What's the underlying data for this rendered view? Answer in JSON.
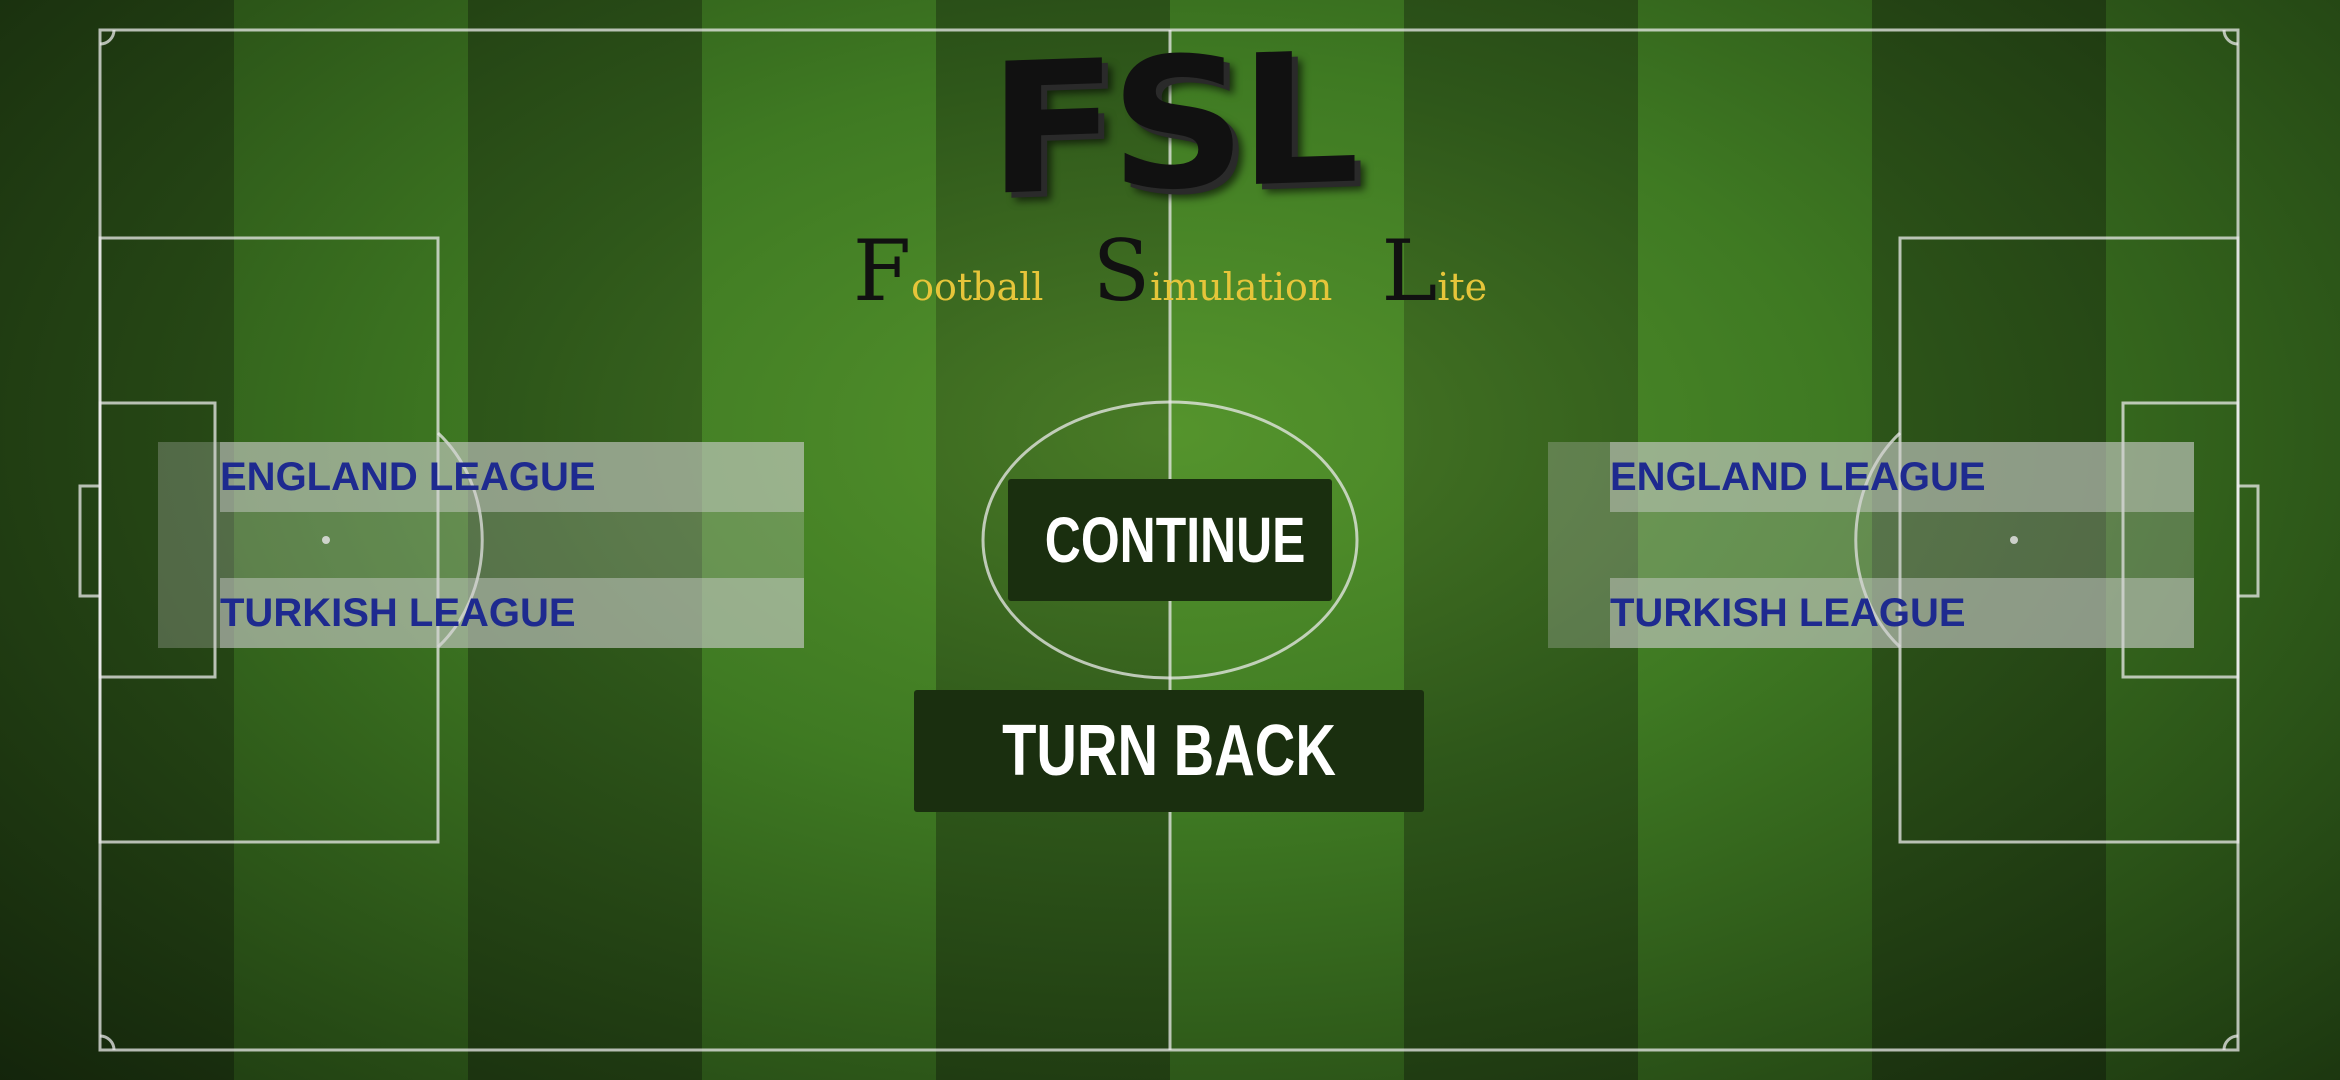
{
  "app": {
    "logo": "FSL",
    "subtitle": [
      {
        "cap": "F",
        "rest": "ootball"
      },
      {
        "cap": "S",
        "rest": "imulation"
      },
      {
        "cap": "L",
        "rest": "ite"
      }
    ]
  },
  "league_panels": {
    "left": {
      "items": [
        {
          "label": "ENGLAND LEAGUE"
        },
        {
          "label": "TURKISH LEAGUE"
        }
      ]
    },
    "right": {
      "items": [
        {
          "label": "ENGLAND LEAGUE"
        },
        {
          "label": "TURKISH LEAGUE"
        }
      ]
    }
  },
  "buttons": {
    "continue_label": "CONTINUE",
    "turn_back_label": "TURN BACK"
  },
  "colors": {
    "pitch_dark": "#2c5219",
    "pitch_light": "#3f7a23",
    "league_text": "#1e2a8f",
    "subtitle_accent": "#e6c53a",
    "button_bg": "#1a2f0f"
  }
}
